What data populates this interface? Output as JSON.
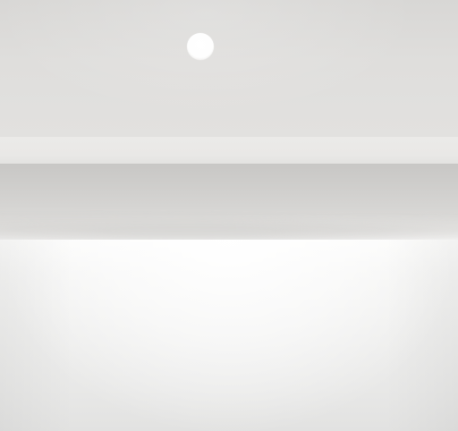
{
  "scene": {
    "colors": {
      "upper_wall": "#dddcda",
      "dot": "#ffffff",
      "ledge": "#eae9e7",
      "shadow": "#c8c7c5",
      "surface": "#f3f3f2"
    }
  }
}
